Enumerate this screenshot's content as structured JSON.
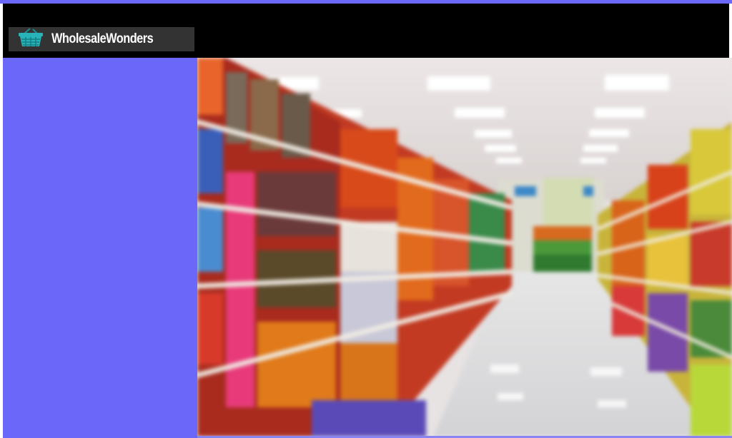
{
  "brand": {
    "name": "WholesaleWonders",
    "icon": "basket-icon"
  },
  "colors": {
    "accent": "#6b67f8",
    "header_bg": "#000000",
    "brand_bg": "#333333",
    "basket": "#27b3b8"
  },
  "hero": {
    "image": "supermarket-aisle-photo"
  }
}
